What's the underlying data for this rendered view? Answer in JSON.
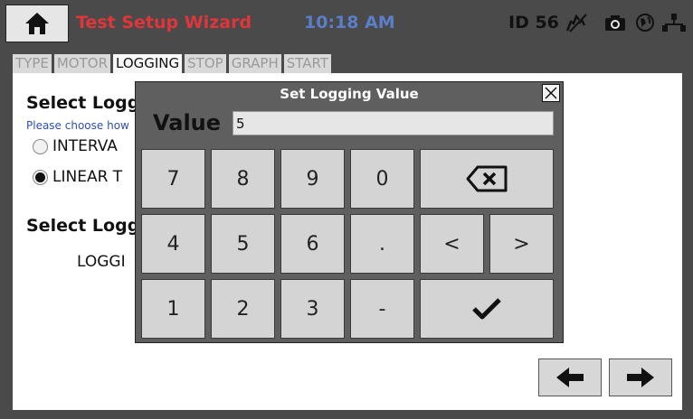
{
  "header": {
    "title": "Test Setup Wizard",
    "time": "10:18 AM",
    "device_id": "ID 56",
    "icons": [
      "home-icon",
      "wireless-off-icon",
      "camera-icon",
      "globe-icon",
      "network-icon"
    ]
  },
  "tabs": [
    {
      "label": "TYPE",
      "active": false
    },
    {
      "label": "MOTOR",
      "active": false
    },
    {
      "label": "LOGGING",
      "active": true
    },
    {
      "label": "STOP",
      "active": false
    },
    {
      "label": "GRAPH",
      "active": false
    },
    {
      "label": "START",
      "active": false
    }
  ],
  "content": {
    "section1_title": "Select Logg",
    "hint": "Please choose how",
    "radio_options": [
      {
        "label": "INTERVA",
        "selected": false
      },
      {
        "label": "LINEAR T",
        "selected": true
      }
    ],
    "section2_title": "Select Logg",
    "logging_label": "LOGGI"
  },
  "dialog": {
    "title": "Set Logging Value",
    "value_label": "Value",
    "value": "5",
    "keys": {
      "k7": "7",
      "k8": "8",
      "k9": "9",
      "k0": "0",
      "k4": "4",
      "k5": "5",
      "k6": "6",
      "kdot": ".",
      "kleft": "<",
      "kright": ">",
      "k1": "1",
      "k2": "2",
      "k3": "3",
      "kminus": "-"
    },
    "icons": [
      "close-icon",
      "backspace-icon",
      "checkmark-icon"
    ]
  },
  "navigation": {
    "icons": [
      "arrow-left-icon",
      "arrow-right-icon"
    ]
  },
  "colors": {
    "chrome": "#4a4a4a",
    "title": "#e0353b",
    "clock": "#5b7ec9",
    "dialog": "#5f5f5f",
    "key": "#d4d4d4"
  }
}
